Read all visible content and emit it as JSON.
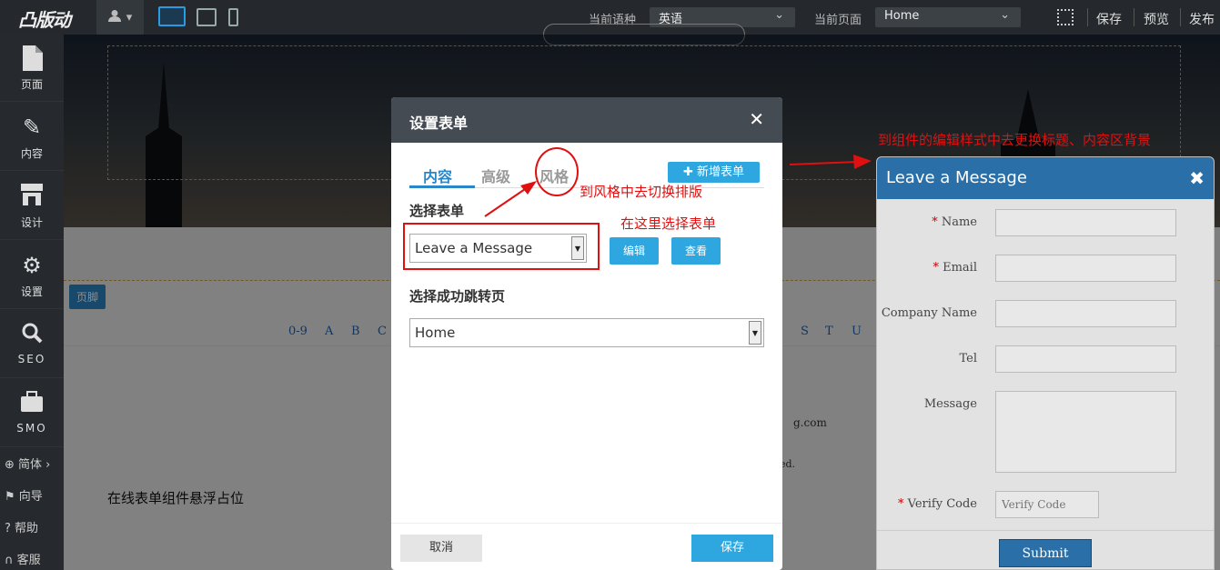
{
  "topbar": {
    "logo": "凸版动",
    "user_icon": "user-icon",
    "lang_label": "当前语种",
    "lang_value": "英语",
    "page_label": "当前页面",
    "page_value": "Home",
    "save": "保存",
    "preview": "预览",
    "publish": "发布"
  },
  "sidebar": {
    "items": [
      {
        "label": "页面",
        "icon": "page-icon"
      },
      {
        "label": "内容",
        "icon": "pencil-icon"
      },
      {
        "label": "设计",
        "icon": "store-icon"
      },
      {
        "label": "设置",
        "icon": "gear-icon"
      },
      {
        "label": "SEO",
        "icon": "search-icon"
      },
      {
        "label": "SMO",
        "icon": "briefcase-icon"
      }
    ],
    "links": [
      "简体 ›",
      "向导",
      "帮助",
      "客服"
    ]
  },
  "canvas": {
    "footer_tag": "页脚",
    "az_left": [
      "0-9",
      "A",
      "B",
      "C"
    ],
    "az_right": [
      "S",
      "T",
      "U"
    ],
    "email_fragment": "g.com",
    "copyright_fragment": "ed.",
    "placeholder_note": "在线表单组件悬浮占位"
  },
  "modal": {
    "title": "设置表单",
    "tabs": [
      "内容",
      "高级",
      "风格"
    ],
    "add_form": "新增表单",
    "select_form_label": "选择表单",
    "selected_form": "Leave a Message",
    "edit": "编辑",
    "view": "查看",
    "redirect_label": "选择成功跳转页",
    "redirect_value": "Home",
    "cancel": "取消",
    "save": "保存"
  },
  "annotations": {
    "style_hint": "到风格中去切换排版",
    "select_hint": "在这里选择表单",
    "widget_hint": "到组件的编辑样式中去更换标题、内容区背景"
  },
  "form_widget": {
    "title": "Leave a Message",
    "fields": [
      {
        "label": "Name",
        "required": true
      },
      {
        "label": "Email",
        "required": true
      },
      {
        "label": "Company Name",
        "required": false
      },
      {
        "label": "Tel",
        "required": false
      },
      {
        "label": "Message",
        "required": false
      }
    ],
    "verify_label": "Verify Code",
    "verify_placeholder": "Verify Code",
    "submit": "Submit"
  }
}
